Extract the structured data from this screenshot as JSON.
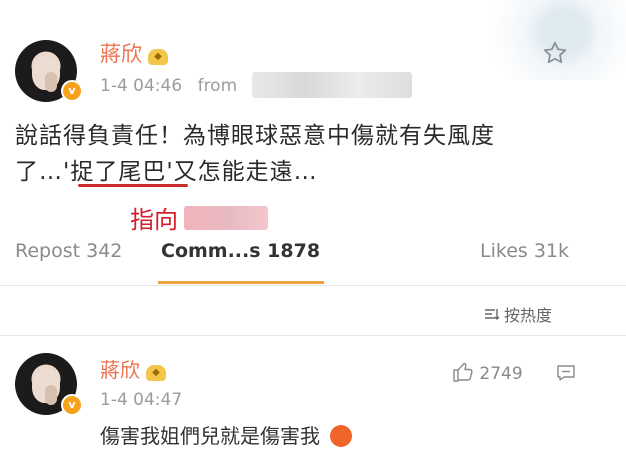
{
  "post": {
    "author": "蔣欣",
    "timestamp": "1-4 04:46",
    "from_label": "from",
    "text_line1": "說話得負責任！為博眼球惡意中傷就有失風度",
    "text_line2": "了…'捉了尾巴'又怎能走遠…"
  },
  "annotation": {
    "text": "指向"
  },
  "tabs": {
    "repost": "Repost 342",
    "comments": "Comm...s 1878",
    "likes": "Likes 31k"
  },
  "sort": {
    "label": "按热度"
  },
  "comment": {
    "author": "蔣欣",
    "timestamp": "1-4 04:47",
    "likes": "2749",
    "text": "傷害我姐們兒就是傷害我"
  },
  "icons": {
    "star": "star-icon",
    "verified": "verified-badge-icon",
    "crown": "vip-crown-icon",
    "sort": "sort-icon",
    "thumb": "thumb-up-icon",
    "reply": "comment-icon",
    "emoji": "angry-emoji-icon"
  },
  "colors": {
    "name": "#eb7350",
    "annotation": "#d21f2b",
    "tab_indicator": "#f3a242"
  }
}
